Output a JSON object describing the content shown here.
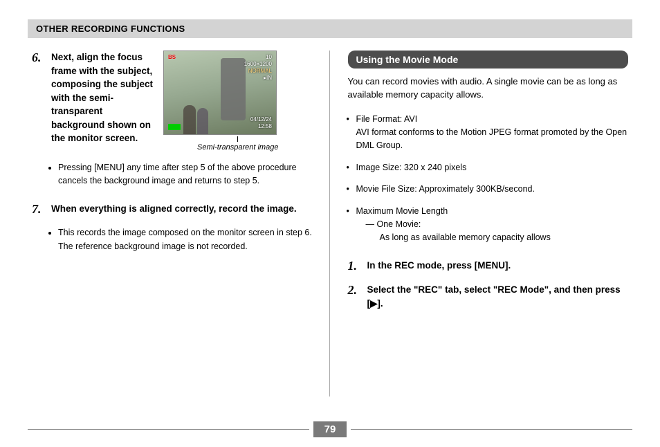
{
  "header": "OTHER RECORDING FUNCTIONS",
  "left": {
    "step6": {
      "num": "6.",
      "text": "Next, align the focus frame with the subject, composing the subject with the semi-transparent background shown on the monitor screen.",
      "thumb": {
        "bs": "BS",
        "line1": "10",
        "line2": "1600×1200",
        "line3": "NORMAL",
        "line4": "▸IN",
        "date": "04/12/24",
        "time": "12:58",
        "caption": "Semi-transparent image"
      },
      "bullet": "Pressing [MENU] any time after step 5 of the above procedure cancels the background image and returns to step 5."
    },
    "step7": {
      "num": "7.",
      "text": "When everything is aligned correctly, record the image.",
      "bullet": "This records the image composed on the monitor screen in step 6. The reference background image is not recorded."
    }
  },
  "right": {
    "section_title": "Using the Movie Mode",
    "intro": "You can record movies with audio. A single movie can be as long as available memory capacity allows.",
    "bul1a": "File Format: AVI",
    "bul1b": "AVI format conforms to the Motion JPEG format promoted by the Open DML Group.",
    "bul2": "Image Size: 320 x 240 pixels",
    "bul3": "Movie File Size: Approximately 300KB/second.",
    "bul4a": "Maximum Movie Length",
    "bul4b_label": "— One Movie:",
    "bul4b_text": "As long as available memory capacity allows",
    "step1": {
      "num": "1.",
      "text": "In the REC mode, press [MENU]."
    },
    "step2": {
      "num": "2.",
      "text": "Select the \"REC\" tab, select \"REC Mode\", and then press [▶]."
    }
  },
  "page_number": "79"
}
